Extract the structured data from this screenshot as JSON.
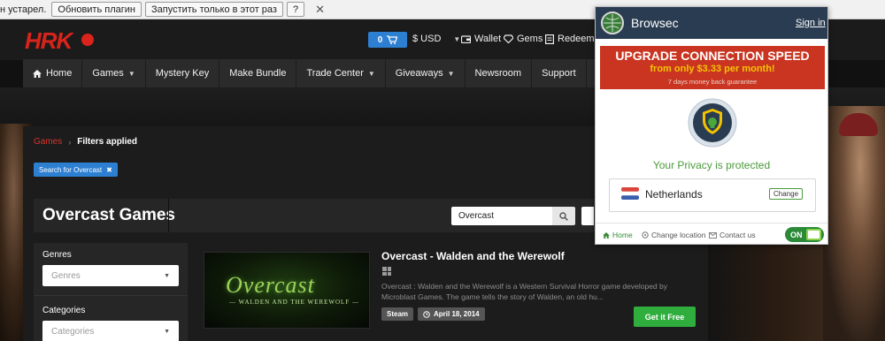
{
  "plugin_bar": {
    "message": "н устарел.",
    "update_button": "Обновить плагин",
    "run_once_button": "Запустить только в этот раз",
    "help_button": "?",
    "close_glyph": "✕"
  },
  "header": {
    "logo": "HRK",
    "cart_count": "0",
    "currency": "$ USD",
    "wallet": "Wallet",
    "gems": "Gems",
    "redeem": "Redeem"
  },
  "nav": {
    "items": [
      "Home",
      "Games",
      "Mystery Key",
      "Make Bundle",
      "Trade Center",
      "Giveaways",
      "Newsroom",
      "Support"
    ],
    "right_fragment": "S"
  },
  "breadcrumb": {
    "parent": "Games",
    "current": "Filters applied"
  },
  "filter_chip": {
    "label": "Search for Overcast",
    "remove_glyph": "✖"
  },
  "page": {
    "title": "Overcast Games",
    "search_value": "Overcast"
  },
  "sidebar": {
    "genres_label": "Genres",
    "genres_placeholder": "Genres",
    "categories_label": "Categories",
    "categories_placeholder": "Categories"
  },
  "game": {
    "image_logo": "Overcast",
    "image_subtitle": "— WALDEN AND THE WEREWOLF —",
    "title": "Overcast - Walden and the Werewolf",
    "description": "Overcast : Walden and the Werewolf is a Western Survival Horror game developed by Microblast Games. The game tells the story of Walden, an old hu...",
    "platform_tag": "Steam",
    "release_date": "April 18, 2014",
    "buy_label": "Get it Free"
  },
  "browsec": {
    "brand": "Browsec",
    "sign_in": "Sign in",
    "promo_title": "UPGRADE CONNECTION SPEED",
    "promo_price": "from only $3.33 per month!",
    "promo_sub": "7 days money back guarantee",
    "privacy_status": "Your Privacy is protected",
    "location": "Netherlands",
    "change_label": "Change",
    "footer_home": "Home",
    "footer_change_location": "Change location",
    "footer_contact": "Contact us",
    "toggle_label": "ON"
  },
  "colors": {
    "brand_red": "#d9231b",
    "accent_blue": "#2d7fd1",
    "buy_green": "#2fae3e",
    "browsec_navy": "#2a3c52",
    "promo_red": "#c93521",
    "privacy_green": "#4a9a3a"
  }
}
